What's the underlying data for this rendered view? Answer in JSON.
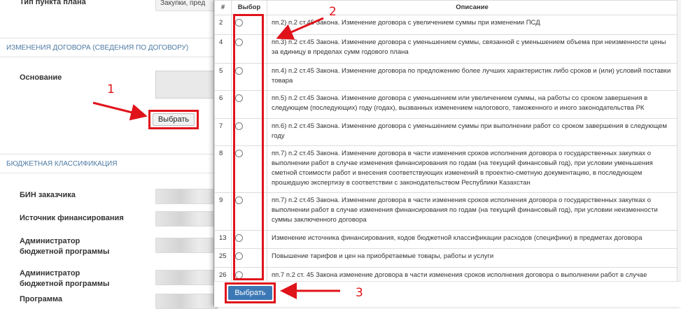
{
  "background_form": {
    "plan_type_label": "Тип пункта плана",
    "plan_type_value": "Закупки, пред",
    "section_contract": "ИЗМЕНЕНИЯ ДОГОВОРА (СВЕДЕНИЯ ПО ДОГОВОРУ)",
    "basis_label": "Основание",
    "choose_button": "Выбрать",
    "section_budget": "БЮДЖЕТНАЯ КЛАССИФИКАЦИЯ",
    "fields": [
      {
        "label": "БИН заказчика"
      },
      {
        "label": "Источник финансирования"
      },
      {
        "label": "Администратор бюджетной программы"
      },
      {
        "label": "Администратор бюджетной программы"
      },
      {
        "label": "Программа"
      }
    ]
  },
  "modal": {
    "columns": {
      "num": "#",
      "choice": "Выбор",
      "description": "Описание"
    },
    "rows": [
      {
        "num": "2",
        "text": "пп.2) п.2 ст.45 Закона. Изменение договора с увеличением суммы при изменении ПСД"
      },
      {
        "num": "4",
        "text": "пп.3) п.2 ст.45 Закона. Изменение договора с уменьшением суммы, связанной с уменьшением объема при неизменности цены за единицу в пределах сумм годового плана"
      },
      {
        "num": "5",
        "text": "пп.4) п.2 ст.45 Закона. Изменение договора по предложению более лучших характеристик либо сроков и (или) условий поставки товара"
      },
      {
        "num": "6",
        "text": "пп.5) п.2 ст.45 Закона. Изменение договора с уменьшением или увеличением суммы, на работы со сроком завершения в следующем (последующих) году (годах), вызванных изменением налогового, таможенного и иного законодательства РК"
      },
      {
        "num": "7",
        "text": "пп.6) п.2 ст.45 Закона. Изменение договора с уменьшением суммы при выполнении работ со сроком завершения в следующем году"
      },
      {
        "num": "8",
        "text": "пп.7) п.2 ст.45 Закона. Изменение договора в части изменения сроков исполнения договора о государственных закупках о выполнении работ в случае изменения финансирования по годам (на текущий финансовый год), при условии  уменьшения сметной стоимости работ и внесения соответствующих изменений в проектно-сметную документацию, в последующем прошедшую экспертизу в соответствии с законодательством Республики Казахстан"
      },
      {
        "num": "9",
        "text": "пп.7) п.2 ст.45 Закона. Изменение договора в части изменения сроков исполнения договора о государственных закупках о выполнении работ в случае изменения финансирования по годам (на текущий финансовый год), при условии неизменности суммы заключенного договора"
      },
      {
        "num": "13",
        "text": "Изменение источника финансирования, кодов бюджетной классификации расходов (специфики) в предметах договора"
      },
      {
        "num": "25",
        "text": "Повышение тарифов и цен на приобретаемые товары, работы и услуги"
      },
      {
        "num": "26",
        "text": "пп.7 п.2 ст. 45 Закона изменение договора в части изменения сроков исполнения договора о выполнении работ в случае"
      }
    ],
    "submit_button": "Выбрать"
  },
  "annotations": {
    "callout_1": "1",
    "callout_2": "2",
    "callout_3": "3",
    "highlight_color": "#e0131b"
  }
}
